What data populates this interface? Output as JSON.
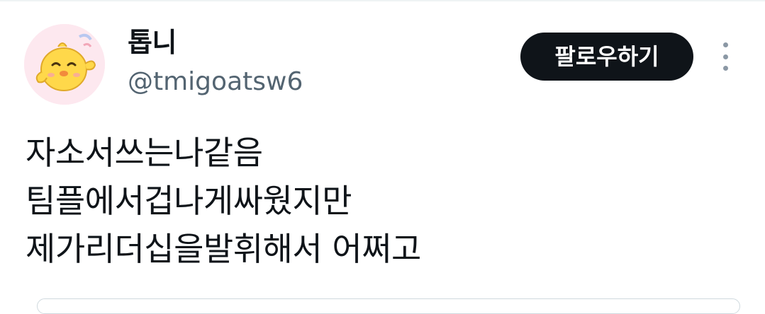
{
  "profile": {
    "display_name": "톱니",
    "handle": "@tmigoatsw6",
    "avatar_icon": "yellow-chick-avatar"
  },
  "actions": {
    "follow_label": "팔로우하기",
    "more_icon": "more-vertical-icon"
  },
  "tweet": {
    "lines": [
      "자소서쓰는나같음",
      "팀플에서겁나게싸웠지만",
      "제가리더십을발휘해서 어쩌고"
    ]
  },
  "colors": {
    "text": "#0f1419",
    "secondary_text": "#536471",
    "follow_button_bg": "#0f1419",
    "follow_button_text": "#ffffff",
    "avatar_bg": "#fde8ef",
    "chick": "#ffd84a"
  }
}
